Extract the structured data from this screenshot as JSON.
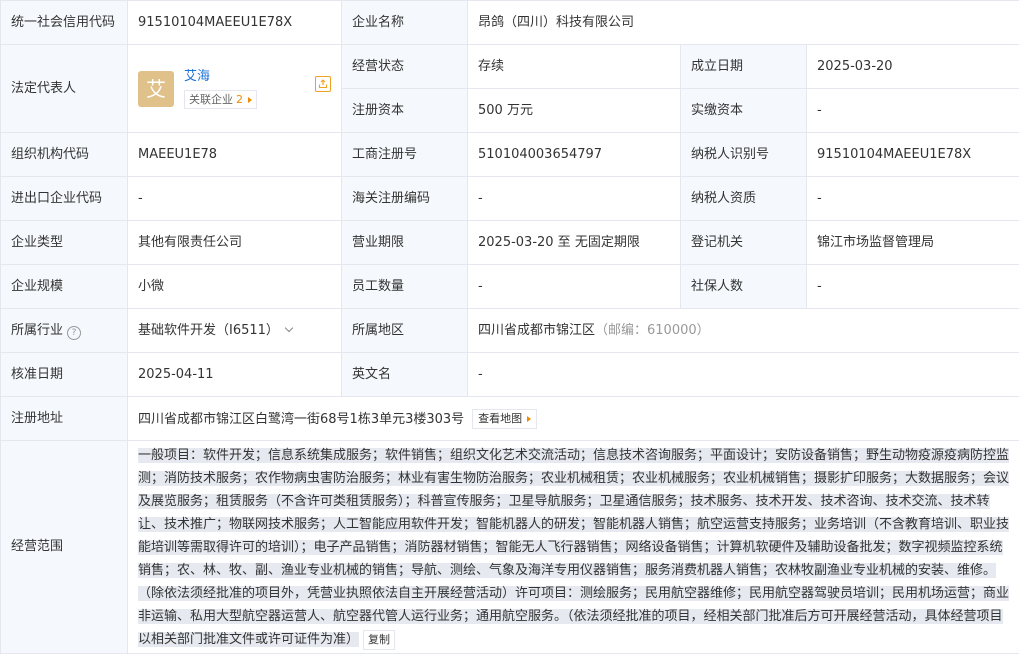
{
  "rows": {
    "r1": {
      "l1": "统一社会信用代码",
      "v1": "91510104MAEEU1E78X",
      "l2": "企业名称",
      "v2": "昂鸽（四川）科技有限公司"
    },
    "rep": {
      "label": "法定代表人",
      "avatar_char": "艾",
      "name": "艾海",
      "rel_label": "关联企业",
      "rel_count": "2"
    },
    "r2": {
      "l1": "经营状态",
      "v1": "存续",
      "l2": "成立日期",
      "v2": "2025-03-20"
    },
    "r3": {
      "l1": "注册资本",
      "v1": "500 万元",
      "l2": "实缴资本",
      "v2": "-"
    },
    "r4": {
      "l1": "组织机构代码",
      "v1": "MAEEU1E78",
      "l2": "工商注册号",
      "v2": "510104003654797",
      "l3": "纳税人识别号",
      "v3": "91510104MAEEU1E78X"
    },
    "r5": {
      "l1": "进出口企业代码",
      "v1": "-",
      "l2": "海关注册编码",
      "v2": "-",
      "l3": "纳税人资质",
      "v3": "-"
    },
    "r6": {
      "l1": "企业类型",
      "v1": "其他有限责任公司",
      "l2": "营业期限",
      "v2": "2025-03-20 至 无固定期限",
      "l3": "登记机关",
      "v3": "锦江市场监督管理局"
    },
    "r7": {
      "l1": "企业规模",
      "v1": "小微",
      "l2": "员工数量",
      "v2": "-",
      "l3": "社保人数",
      "v3": "-"
    },
    "r8": {
      "l1": "所属行业",
      "help_icon": "?",
      "v1": "基础软件开发（I6511）",
      "l2": "所属地区",
      "v2": "四川省成都市锦江区",
      "v2_postal": "（邮编：610000）"
    },
    "r9": {
      "l1": "核准日期",
      "v1": "2025-04-11",
      "l2": "英文名",
      "v2": "-"
    },
    "r10": {
      "l1": "注册地址",
      "v1": "四川省成都市锦江区白鹭湾一街68号1栋3单元3楼303号",
      "map_btn": "查看地图"
    },
    "r11": {
      "l1": "经营范围",
      "v1": "一般项目：软件开发；信息系统集成服务；软件销售；组织文化艺术交流活动；信息技术咨询服务；平面设计；安防设备销售；野生动物疫源疫病防控监测；消防技术服务；农作物病虫害防治服务；林业有害生物防治服务；农业机械租赁；农业机械服务；农业机械销售；摄影扩印服务；大数据服务；会议及展览服务；租赁服务（不含许可类租赁服务）；科普宣传服务；卫星导航服务；卫星通信服务；技术服务、技术开发、技术咨询、技术交流、技术转让、技术推广；物联网技术服务；人工智能应用软件开发；智能机器人的研发；智能机器人销售；航空运营支持服务；业务培训（不含教育培训、职业技能培训等需取得许可的培训）；电子产品销售；消防器材销售；智能无人飞行器销售；网络设备销售；计算机软硬件及辅助设备批发；数字视频监控系统销售；农、林、牧、副、渔业专业机械的销售；导航、测绘、气象及海洋专用仪器销售；服务消费机器人销售；农林牧副渔业专业机械的安装、维修。（除依法须经批准的项目外，凭营业执照依法自主开展经营活动）许可项目：测绘服务；民用航空器维修；民用航空器驾驶员培训；民用机场运营；商业非运输、私用大型航空器运营人、航空器代管人运行业务；通用航空服务。（依法须经批准的项目，经相关部门批准后方可开展经营活动，具体经营项目以相关部门批准文件或许可证件为准）",
      "copy_btn": "复制"
    }
  },
  "icons": {
    "share": "share-icon",
    "help": "help-circle-icon",
    "chevron": "chevron-down-icon",
    "arrow": "triangle-right-icon"
  },
  "colors": {
    "label_bg": "#f5f8fc",
    "border": "#e4e8ee",
    "link": "#1f73d8",
    "accent": "#f08a00",
    "avatar": "#e0c18a",
    "scope_highlight": "#e6eaf0"
  }
}
